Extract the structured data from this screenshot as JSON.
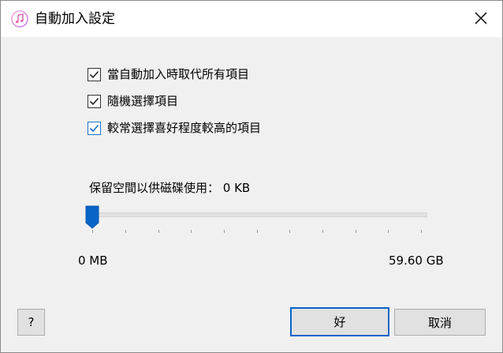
{
  "window": {
    "title": "自動加入設定",
    "app_icon": "itunes-music-note-icon",
    "close_icon": "close-x-icon"
  },
  "options": {
    "items": [
      {
        "label": "當自動加入時取代所有項目",
        "checked": true
      },
      {
        "label": "隨機選擇項目",
        "checked": true
      },
      {
        "label": "較常選擇喜好程度較高的項目",
        "checked": true
      }
    ]
  },
  "reserve": {
    "label": "保留空間以供磁碟使用： 0 KB",
    "slider_value_fraction": 0,
    "min_label": "0 MB",
    "max_label": "59.60 GB"
  },
  "buttons": {
    "help_label": "?",
    "ok_label": "好",
    "cancel_label": "取消"
  },
  "colors": {
    "accent": "#1a73c9",
    "button_face": "#e1e1e1",
    "dialog_background": "#f0f0f0",
    "slider_thumb": "#0a64c8"
  }
}
